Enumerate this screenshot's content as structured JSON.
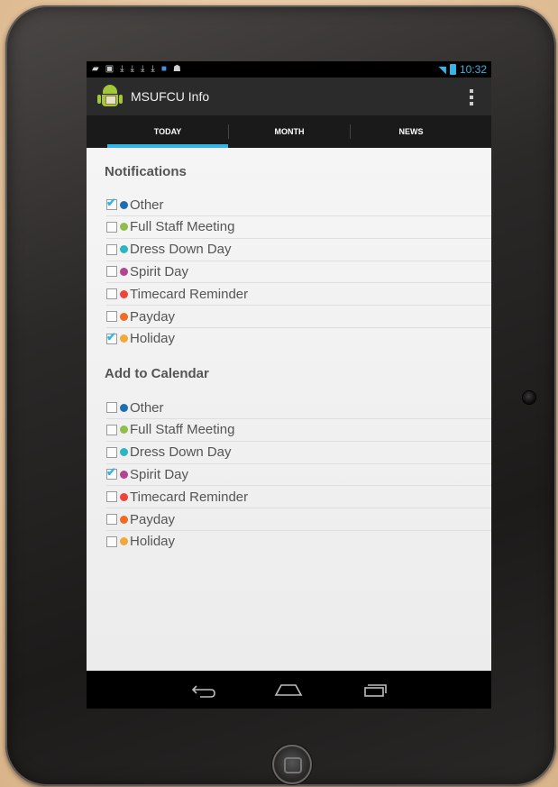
{
  "status_bar": {
    "time": "10:32",
    "notification_icons": [
      "chat-icon",
      "image-icon",
      "download-icon",
      "download-icon",
      "download-icon",
      "download-icon",
      "photo-icon",
      "gamepad-icon"
    ]
  },
  "action_bar": {
    "app_title": "MSUFCU Info"
  },
  "tabs": [
    {
      "label": "TODAY",
      "selected": true
    },
    {
      "label": "MONTH",
      "selected": false
    },
    {
      "label": "NEWS",
      "selected": false
    }
  ],
  "notifications": {
    "title": "Notifications",
    "items": [
      {
        "label": "Other",
        "checked": true,
        "color": "#1e6fae"
      },
      {
        "label": "Full Staff Meeting",
        "checked": false,
        "color": "#8fbe4a"
      },
      {
        "label": "Dress Down Day",
        "checked": false,
        "color": "#2bb6c4"
      },
      {
        "label": "Spirit Day",
        "checked": false,
        "color": "#b2458e"
      },
      {
        "label": "Timecard Reminder",
        "checked": false,
        "color": "#f0433b"
      },
      {
        "label": "Payday",
        "checked": false,
        "color": "#f26b22"
      },
      {
        "label": "Holiday",
        "checked": true,
        "color": "#f0a93a"
      }
    ]
  },
  "add_to_calendar": {
    "title": "Add to Calendar",
    "items": [
      {
        "label": "Other",
        "checked": false,
        "color": "#1e6fae"
      },
      {
        "label": "Full Staff Meeting",
        "checked": false,
        "color": "#8fbe4a"
      },
      {
        "label": "Dress Down Day",
        "checked": false,
        "color": "#2bb6c4"
      },
      {
        "label": "Spirit Day",
        "checked": true,
        "color": "#b2458e"
      },
      {
        "label": "Timecard Reminder",
        "checked": false,
        "color": "#f0433b"
      },
      {
        "label": "Payday",
        "checked": false,
        "color": "#f26b22"
      },
      {
        "label": "Holiday",
        "checked": false,
        "color": "#f0a93a"
      }
    ]
  },
  "colors": {
    "accent": "#33b5e5",
    "action_bar": "#2b2b2b",
    "tab_bar": "#1a1a1a"
  },
  "nav_bar": {
    "buttons": [
      "back-icon",
      "home-icon",
      "recent-apps-icon"
    ]
  }
}
